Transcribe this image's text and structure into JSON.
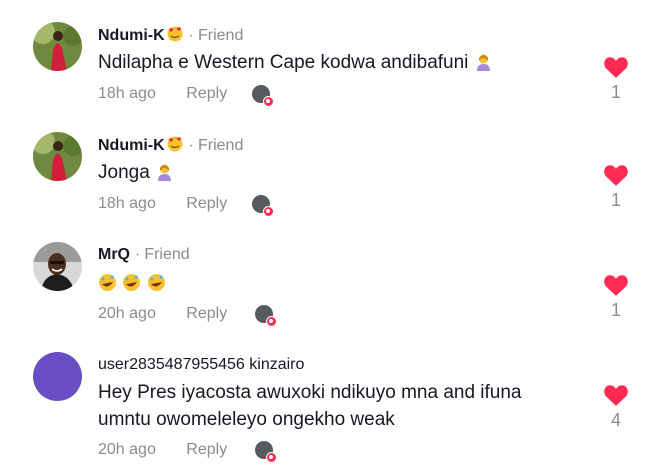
{
  "comments": [
    {
      "author": "Ndumi-K",
      "relation": "Friend",
      "text": "Ndilapha e Western Cape kodwa andibafuni",
      "time": "18h ago",
      "reply_label": "Reply",
      "like_count": "1"
    },
    {
      "author": "Ndumi-K",
      "relation": "Friend",
      "text": "Jonga",
      "time": "18h ago",
      "reply_label": "Reply",
      "like_count": "1"
    },
    {
      "author": "MrQ",
      "relation": "Friend",
      "text": "",
      "time": "20h ago",
      "reply_label": "Reply",
      "like_count": "1"
    },
    {
      "author": "user2835487955456",
      "nickname": "kinzairo",
      "text": "Hey Pres iyacosta awuxoki ndikuyo mna and ifuna umntu owomeleleyo ongekho weak",
      "time": "20h ago",
      "reply_label": "Reply",
      "like_count": "4"
    }
  ],
  "separator": "·",
  "icons": {
    "like": "heart-icon",
    "author_badge": "smiling-face-with-hearts-emoji",
    "inline_emoji": "person-gesturing-emoji",
    "laugh_emoji": "rolling-on-floor-laughing-emoji",
    "creator_liked": "creator-liked-badge"
  },
  "colors": {
    "like_red": "#fe2c55",
    "meta_gray": "#8a8b91",
    "text": "#161823",
    "purple_avatar": "#6a4fc4"
  }
}
